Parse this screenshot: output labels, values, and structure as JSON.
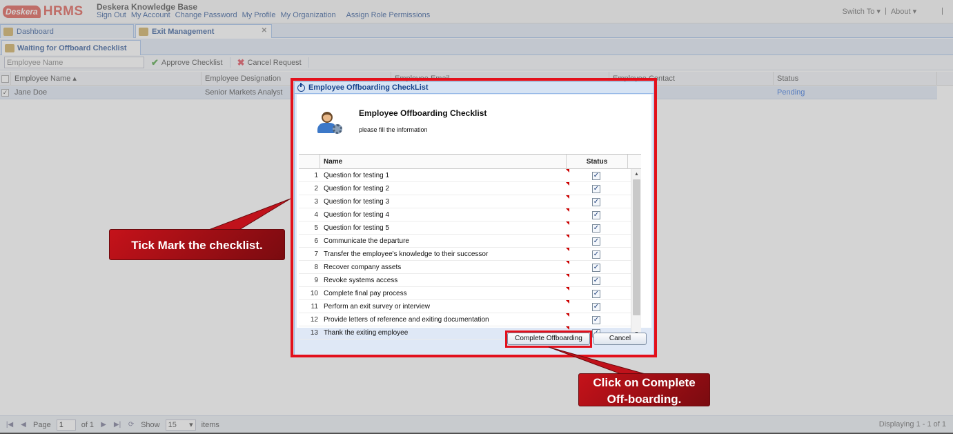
{
  "app": {
    "logo_badge": "Desk",
    "logo_badge_rest": "era",
    "logo_name": "HRMS",
    "title": "Deskera Knowledge Base",
    "top_links": [
      "Sign Out",
      "My Account",
      "Change Password",
      "My Profile",
      "My Organization",
      "Assign Role Permissions"
    ],
    "switch_to": "Switch To ▾",
    "separator": "|",
    "about": "About ▾"
  },
  "tabs": {
    "dashboard": "Dashboard",
    "exit_management": "Exit Management",
    "close_glyph": "✕"
  },
  "subtab": {
    "label": "Waiting for Offboard Checklist"
  },
  "toolbar": {
    "search_placeholder": "Employee Name",
    "approve": "Approve Checklist",
    "cancel": "Cancel Request"
  },
  "grid": {
    "columns": [
      "Employee Name ▴",
      "Employee Designation",
      "Employee Email",
      "Employee Contact",
      "Status"
    ],
    "row": {
      "name": "Jane Doe",
      "designation": "Senior Markets Analyst",
      "status": "Pending"
    }
  },
  "pager": {
    "page_label": "Page",
    "page_value": "1",
    "of_label": "of 1",
    "show_label": "Show",
    "show_value": "15",
    "items_label": "items",
    "display": "Displaying 1 - 1 of 1"
  },
  "dialog": {
    "window_title": "Employee Offboarding CheckList",
    "header_title": "Employee Offboarding Checklist",
    "header_sub": "please fill the information",
    "col_name": "Name",
    "col_status": "Status",
    "items": [
      {
        "n": "1",
        "name": "Question for testing 1",
        "checked": true
      },
      {
        "n": "2",
        "name": "Question for testing 2",
        "checked": true
      },
      {
        "n": "3",
        "name": "Question for testing 3",
        "checked": true
      },
      {
        "n": "4",
        "name": "Question for testing 4",
        "checked": true
      },
      {
        "n": "5",
        "name": "Question for testing 5",
        "checked": true
      },
      {
        "n": "6",
        "name": "Communicate the departure",
        "checked": true
      },
      {
        "n": "7",
        "name": "Transfer the employee's knowledge to their successor",
        "checked": true
      },
      {
        "n": "8",
        "name": "Recover company assets",
        "checked": true
      },
      {
        "n": "9",
        "name": "Revoke systems access",
        "checked": true
      },
      {
        "n": "10",
        "name": "Complete final pay process",
        "checked": true
      },
      {
        "n": "11",
        "name": "Perform an exit survey or interview",
        "checked": true
      },
      {
        "n": "12",
        "name": "Provide letters of reference and exiting documentation",
        "checked": true
      },
      {
        "n": "13",
        "name": "Thank the exiting employee",
        "checked": true
      }
    ],
    "complete_button": "Complete Offboarding",
    "cancel_button": "Cancel"
  },
  "callouts": {
    "tick": "Tick Mark the checklist.",
    "click_line1": "Click on Complete",
    "click_line2": "Off-boarding."
  },
  "colors": {
    "highlight": "#e3101c",
    "callout": "#b8101a",
    "accent": "#15428b"
  }
}
